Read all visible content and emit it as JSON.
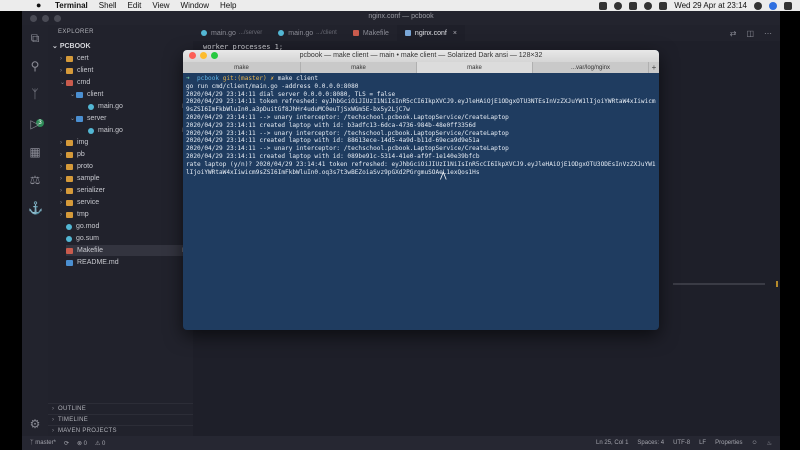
{
  "menubar": {
    "apple": "",
    "items": [
      "Terminal",
      "Shell",
      "Edit",
      "View",
      "Window",
      "Help"
    ],
    "clock": "Wed 29 Apr at 23:14"
  },
  "vscode": {
    "window_title": "nginx.conf — pcbook",
    "explorer_title": "EXPLORER",
    "root": "PCBOOK",
    "tree": [
      {
        "label": "cert",
        "kind": "folder"
      },
      {
        "label": "client",
        "kind": "folder"
      },
      {
        "label": "cmd",
        "kind": "folder-red",
        "mark": "●"
      },
      {
        "label": "client",
        "kind": "folder-blue",
        "mark": "●"
      },
      {
        "label": "main.go",
        "kind": "go",
        "mark": "M"
      },
      {
        "label": "server",
        "kind": "folder-blue",
        "mark": "●"
      },
      {
        "label": "main.go",
        "kind": "go",
        "mark": "M"
      },
      {
        "label": "img",
        "kind": "folder"
      },
      {
        "label": "pb",
        "kind": "folder"
      },
      {
        "label": "proto",
        "kind": "folder"
      },
      {
        "label": "sample",
        "kind": "folder"
      },
      {
        "label": "serializer",
        "kind": "folder"
      },
      {
        "label": "service",
        "kind": "folder"
      },
      {
        "label": "tmp",
        "kind": "folder"
      },
      {
        "label": "go.mod",
        "kind": "go"
      },
      {
        "label": "go.sum",
        "kind": "go"
      },
      {
        "label": "Makefile",
        "kind": "mk",
        "mark": "M"
      },
      {
        "label": "README.md",
        "kind": "md"
      }
    ],
    "sections": [
      "OUTLINE",
      "TIMELINE",
      "MAVEN PROJECTS"
    ],
    "tabs": [
      {
        "label": "main.go",
        "desc": ".../server",
        "icon": "go"
      },
      {
        "label": "main.go",
        "desc": ".../client",
        "icon": "go"
      },
      {
        "label": "Makefile",
        "desc": "",
        "icon": "mk"
      },
      {
        "label": "nginx.conf",
        "desc": "",
        "icon": "cfg",
        "active": true
      }
    ],
    "code_first_line": "worker_processes  1;",
    "status": {
      "branch": "master*",
      "errors": "⊗ 0",
      "warnings": "⚠ 0",
      "position": "Ln 25, Col 1",
      "spaces": "Spaces: 4",
      "encoding": "UTF-8",
      "eol": "LF",
      "language": "Properties"
    }
  },
  "terminal": {
    "title": "pcbook — make client — main • make client — Solarized Dark ansi — 128×32",
    "tabs": [
      "make",
      "make",
      "make",
      "...var/log/nginx"
    ],
    "active_tab": 2,
    "prompt": {
      "arrow": "➜",
      "dir": "pcbook",
      "git": "git:(master)",
      "x": "✗",
      "cmd": "make client"
    },
    "lines": [
      "go run cmd/client/main.go -address 0.0.0.0:8080",
      "2020/04/29 23:14:11 dial server 0.0.0.0:8080, TLS = false",
      "2020/04/29 23:14:11 token refreshed: eyJhbGciOiJIUzI1NiIsInR5cCI6IkpXVCJ9.eyJleHAiOjE1ODgxOTU3NTEsInVzZXJuYW1lIjoiYWRtaW4xIiwicm",
      "9sZSI6ImFkbWluIn0.a3pDuitGf8JhHr4uduMC0euTjSxWGm5E-bx5y2LjC7w",
      "2020/04/29 23:14:11 --> unary interceptor: /techschool.pcbook.LaptopService/CreateLaptop",
      "2020/04/29 23:14:11 created laptop with id: b3adfc13-6dca-4736-984b-48e0ff3356d",
      "2020/04/29 23:14:11 --> unary interceptor: /techschool.pcbook.LaptopService/CreateLaptop",
      "2020/04/29 23:14:11 created laptop with id: 88613ece-14d5-4a9d-b11d-69eca9d9e51a",
      "2020/04/29 23:14:11 --> unary interceptor: /techschool.pcbook.LaptopService/CreateLaptop",
      "2020/04/29 23:14:11 created laptop with id: 089be91c-5314-41e0-af9f-1e140e39bfcb",
      "rate laptop (y/n)? 2020/04/29 23:14:41 token refreshed: eyJhbGciOiJIUzI1NiIsInR5cCI6IkpXVCJ9.eyJleHAiOjE1ODgxOTU3ODEsInVzZXJuYW1",
      "lIjoiYWRtaW4xIiwicm9sZSI6ImFkbWluIn0.oq3s7t3wBEZoiaSvz9pGXd2PGrgmuSOAeL1exQos1Hs"
    ]
  }
}
